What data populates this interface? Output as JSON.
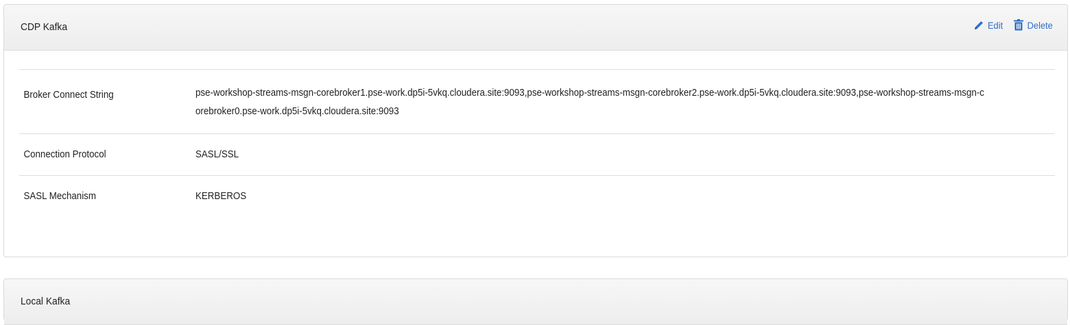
{
  "panels": [
    {
      "title": "CDP Kafka",
      "actions": {
        "edit_label": "Edit",
        "delete_label": "Delete"
      },
      "rows": [
        {
          "label": "Broker Connect String",
          "value": "pse-workshop-streams-msgn-corebroker1.pse-work.dp5i-5vkq.cloudera.site:9093,pse-workshop-streams-msgn-corebroker2.pse-work.dp5i-5vkq.cloudera.site:9093,pse-workshop-streams-msgn-corebroker0.pse-work.dp5i-5vkq.cloudera.site:9093"
        },
        {
          "label": "Connection Protocol",
          "value": "SASL/SSL"
        },
        {
          "label": "SASL Mechanism",
          "value": "KERBEROS"
        }
      ]
    },
    {
      "title": "Local Kafka"
    }
  ],
  "colors": {
    "link": "#2f6fc6",
    "header_bg": "#f0f0f0",
    "border": "#d9d9d9"
  },
  "icons": {
    "edit": "pencil-icon",
    "delete": "trash-icon"
  }
}
